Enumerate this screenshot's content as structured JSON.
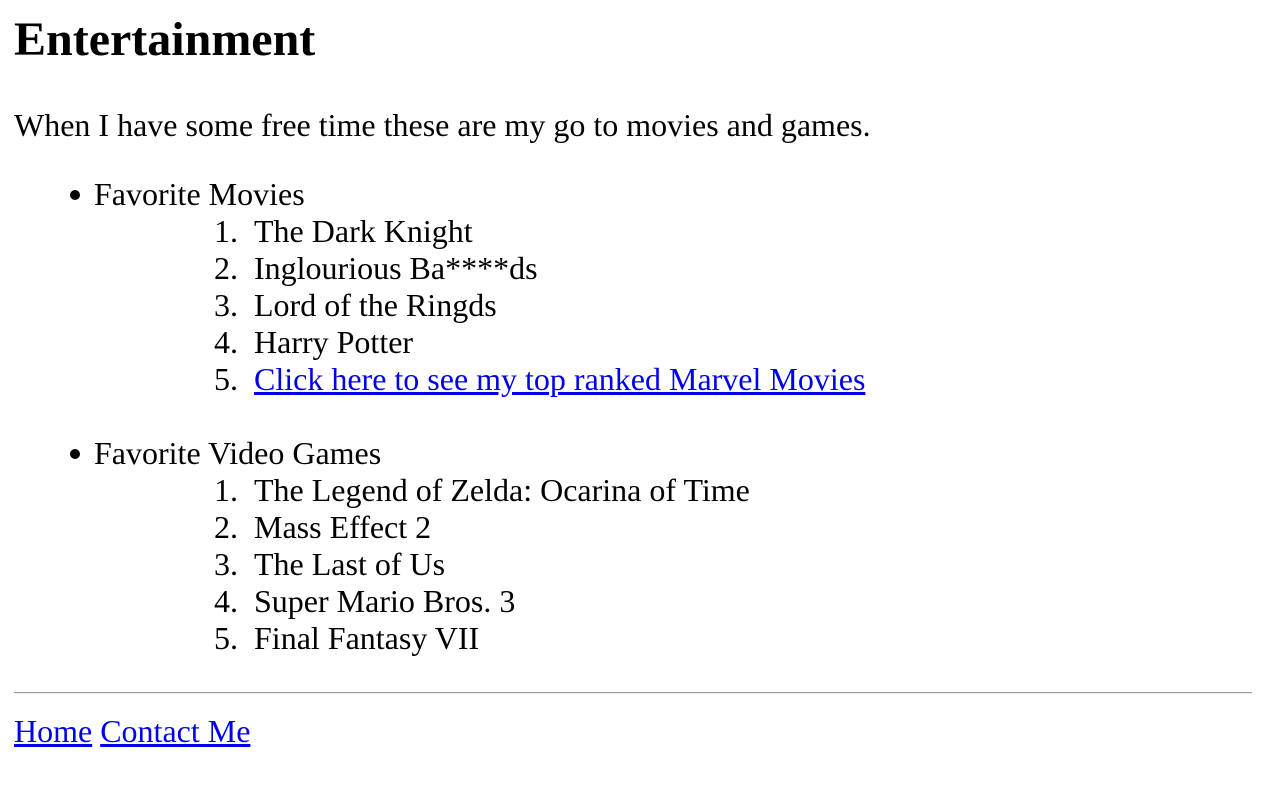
{
  "page": {
    "title": "Entertainment",
    "intro": "When I have some free time these are my go to movies and games."
  },
  "movies": {
    "heading": "Favorite Movies",
    "items": [
      {
        "num": "1",
        "text": "The Dark Knight"
      },
      {
        "num": "2",
        "text": "Inglourious Ba****ds"
      },
      {
        "num": "3",
        "text": "Lord of the Ringds"
      },
      {
        "num": "4",
        "text": "Harry Potter"
      },
      {
        "num": "5",
        "link_text": "Click here to see my top ranked Marvel Movies"
      }
    ]
  },
  "games": {
    "heading": "Favorite Video Games",
    "items": [
      {
        "num": "1",
        "text": "The Legend of Zelda: Ocarina of Time"
      },
      {
        "num": "2",
        "text": "Mass Effect 2"
      },
      {
        "num": "3",
        "text": "The Last of Us"
      },
      {
        "num": "4",
        "text": "Super Mario Bros. 3"
      },
      {
        "num": "5",
        "text": "Final Fantasy VII"
      }
    ]
  },
  "footer": {
    "home_link": "Home",
    "contact_link": "Contact Me"
  },
  "colors": {
    "link": "#0000ee",
    "text": "#000000",
    "background": "#ffffff"
  }
}
